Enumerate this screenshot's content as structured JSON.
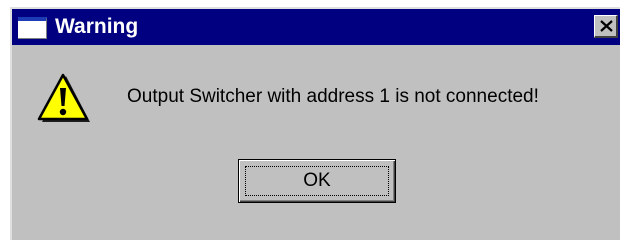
{
  "window": {
    "title": "Warning",
    "title_icon": "window-icon",
    "close_icon": "close-x-icon"
  },
  "body": {
    "icon": "warning-triangle-icon",
    "message": "Output Switcher with address 1 is not connected!"
  },
  "buttons": {
    "ok_label": "OK"
  },
  "colors": {
    "titlebar": "#000080",
    "dialog_face": "#c0c0c0",
    "warning_fill": "#ffff00"
  }
}
